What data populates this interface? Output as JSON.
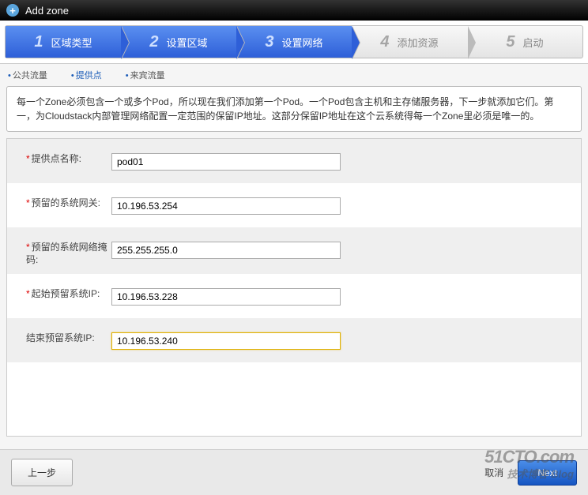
{
  "titlebar": {
    "title": "Add zone",
    "plus_glyph": "+"
  },
  "steps": [
    {
      "num": "1",
      "label": "区域类型",
      "active": true
    },
    {
      "num": "2",
      "label": "设置区域",
      "active": true
    },
    {
      "num": "3",
      "label": "设置网络",
      "active": true
    },
    {
      "num": "4",
      "label": "添加资源",
      "active": false
    },
    {
      "num": "5",
      "label": "启动",
      "active": false
    }
  ],
  "subtabs": [
    {
      "label": "公共流量",
      "active": false
    },
    {
      "label": "提供点",
      "active": true
    },
    {
      "label": "来宾流量",
      "active": false
    }
  ],
  "description": "每一个Zone必须包含一个或多个Pod，所以现在我们添加第一个Pod。一个Pod包含主机和主存储服务器，下一步就添加它们。第一，为Cloudstack内部管理网络配置一定范围的保留IP地址。这部分保留IP地址在这个云系统得每一个Zone里必须是唯一的。",
  "form": {
    "pod_name_label": "提供点名称:",
    "pod_name_value": "pod01",
    "gateway_label": "预留的系统网关:",
    "gateway_value": "10.196.53.254",
    "netmask_label": "预留的系统网络掩码:",
    "netmask_value": "255.255.255.0",
    "start_ip_label": "起始预留系统IP:",
    "start_ip_value": "10.196.53.228",
    "end_ip_label": "结束预留系统IP:",
    "end_ip_value": "10.196.53.240"
  },
  "footer": {
    "prev": "上一步",
    "cancel": "取消",
    "next": "Next"
  },
  "watermark": {
    "line1": "51CTO.com",
    "line2": "技术博客  Blog"
  }
}
